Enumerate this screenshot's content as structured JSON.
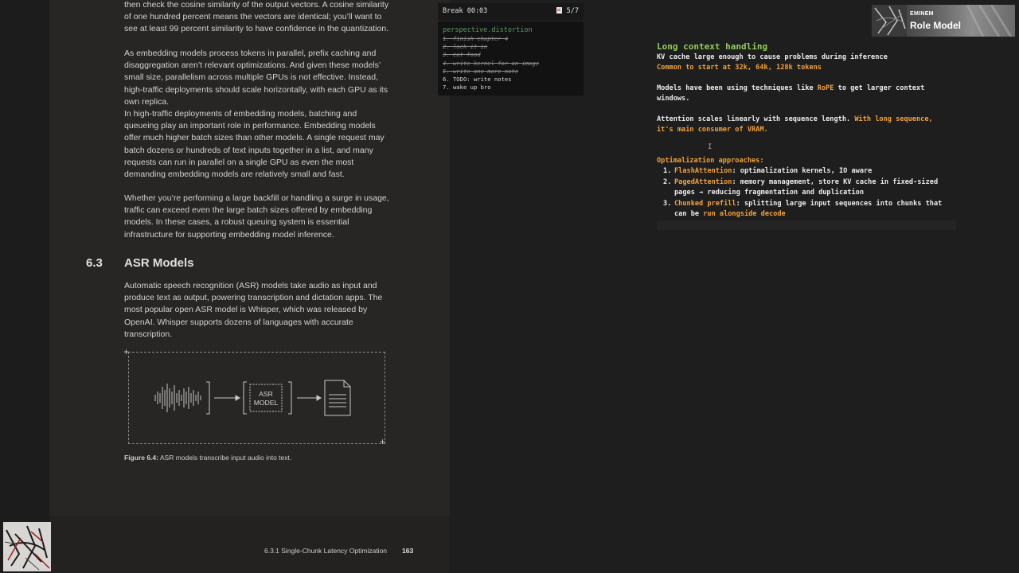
{
  "pdf": {
    "paragraphs": [
      "then check the cosine similarity of the output vectors. A cosine similarity of one hundred percent means the vectors are identical; you’ll want to see at least 99 percent similarity to have confidence in the quantization.",
      "As embedding models process tokens in parallel, prefix caching and disaggregation aren’t relevant optimizations. And given these models’ small size, parallelism across multiple GPUs is not effective. Instead, high-traffic deployments should scale horizontally, with each GPU as its own replica.",
      "In high-traffic deployments of embedding models, batching and queueing play an important role in performance. Embedding models offer much higher batch sizes than other models. A single request may batch dozens or hundreds of text inputs together in a list, and many requests can run in parallel on a single GPU as even the most demanding embedding models are relatively small and fast.",
      "Whether you’re performing a large backfill or handling a surge in usage, traffic can exceed even the large batch sizes offered by embedding models. In these cases, a robust queuing system is essential infrastructure for supporting embedding model inference."
    ],
    "section_number": "6.3",
    "section_title": "ASR Models",
    "section_paragraph": "Automatic speech recognition (ASR) models take audio as input and produce text as output, powering transcription and dictation apps. The most popular open ASR model is Whisper, which was released by OpenAI. Whisper supports dozens of languages with accurate transcription.",
    "figure": {
      "box_label_line1": "ASR",
      "box_label_line2": "MODEL",
      "caption_label": "Figure 6.4:",
      "caption_text": " ASR models transcribe input audio into text."
    },
    "footer": {
      "section": "6.3.1   Single-Chunk Latency Optimization",
      "page": "163"
    }
  },
  "widget": {
    "timer": "Break 00:03",
    "counter": "5/7",
    "list_title": "perspective.distortion",
    "items": [
      {
        "text": "1. finish chapter 4",
        "done": true
      },
      {
        "text": "2. lock it in",
        "done": true
      },
      {
        "text": "3. eat food",
        "done": true
      },
      {
        "text": "4. write kernel for an image",
        "done": true
      },
      {
        "text": "5. write one more note",
        "done": true
      },
      {
        "text": "6. TODO: write notes",
        "done": false
      },
      {
        "text": "7. wake up bro",
        "done": false
      }
    ]
  },
  "notes": {
    "heading": "Long context handling",
    "kv_line": "KV cache large enough to cause problems during inference",
    "common_line": "Common to start at 32k, 64k, 128k tokens",
    "models_a": "Models have been using techniques like ",
    "rope": "RoPE",
    "models_b": " to get larger context",
    "models_c": "windows.",
    "attention_a": "Attention scales linearly with sequence length. ",
    "attention_b": "With long sequence,",
    "attention_c": "it's main consumer of VRAM.",
    "approaches_title": "Optimalization approaches:",
    "approaches": [
      {
        "num": "1.",
        "name": "FlashAttention",
        "rest": ": optimalization kernels, IO aware",
        "cont": ""
      },
      {
        "num": "2.",
        "name": "PagedAttention",
        "rest": ": memory management, store KV cache in fixed-sized",
        "cont": "pages → reducing fragmentation and duplication"
      },
      {
        "num": "3.",
        "name": "Chunked prefill",
        "rest": ": splitting large input sequences into chunks that",
        "cont_a": "can be ",
        "cont_b": "run alongside decode"
      }
    ]
  },
  "now_playing": {
    "artist": "EMINEM",
    "track": "Role Model"
  },
  "colors": {
    "heading_green": "#8fcf59",
    "highlight_orange": "#f2a23b",
    "todo_title_green": "#5f9966"
  },
  "icons": [
    "document-icon",
    "waveform-icon",
    "arrow-right-icon",
    "file-text-icon",
    "text-cursor-icon",
    "album-art-icon"
  ]
}
